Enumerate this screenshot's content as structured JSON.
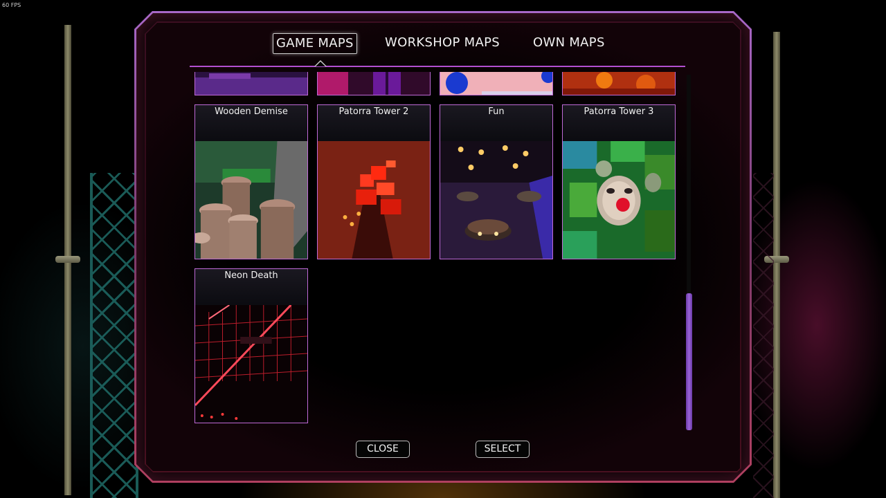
{
  "overlay": {
    "fps_label": "60 FPS"
  },
  "tabs": [
    {
      "label": "GAME MAPS",
      "active": true
    },
    {
      "label": "WORKSHOP MAPS",
      "active": false
    },
    {
      "label": "OWN MAPS",
      "active": false
    }
  ],
  "maps": [
    {
      "title": "Wooden Demise",
      "thumbnail": "wooden-towers-scene"
    },
    {
      "title": "Patorra Tower 2",
      "thumbnail": "red-block-tower-scene"
    },
    {
      "title": "Fun",
      "thumbnail": "creatures-on-platforms-scene"
    },
    {
      "title": "Patorra Tower 3",
      "thumbnail": "green-clown-face-scene"
    },
    {
      "title": "Neon Death",
      "thumbnail": "red-neon-grid-scene"
    }
  ],
  "buttons": {
    "close_label": "CLOSE",
    "select_label": "SELECT"
  },
  "colors": {
    "frame_accent": "#c06ad8",
    "tab_rule": "#b24fd0",
    "scroll_thumb": "#9b63d8",
    "text": "#f2f2f2"
  }
}
